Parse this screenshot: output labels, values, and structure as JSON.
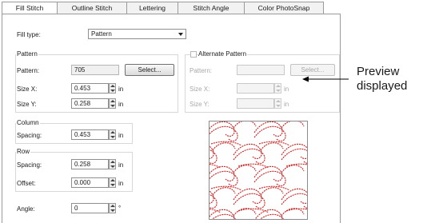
{
  "tabs": [
    "Fill Stitch",
    "Outline Stitch",
    "Lettering",
    "Stitch Angle",
    "Color PhotoSnap"
  ],
  "fill_type": {
    "label": "Fill type:",
    "value": "Pattern"
  },
  "pattern": {
    "group_title": "Pattern",
    "pattern_label": "Pattern:",
    "pattern_value": "705",
    "select_button": "Select...",
    "size_x_label": "Size X:",
    "size_x_value": "0.453",
    "size_y_label": "Size Y:",
    "size_y_value": "0.258"
  },
  "alternate_pattern": {
    "checkbox_label": "Alternate Pattern",
    "checked": false,
    "pattern_label": "Pattern:",
    "select_button": "Select...",
    "size_x_label": "Size X:",
    "size_y_label": "Size Y:"
  },
  "column": {
    "group_title": "Column",
    "spacing_label": "Spacing:",
    "spacing_value": "0.453"
  },
  "row": {
    "group_title": "Row",
    "spacing_label": "Spacing:",
    "spacing_value": "0.258",
    "offset_label": "Offset:",
    "offset_value": "0.000"
  },
  "angle": {
    "label": "Angle:",
    "value": "0",
    "unit": "°"
  },
  "units": {
    "inch": "in"
  },
  "callout": {
    "line1": "Preview",
    "line2": "displayed"
  },
  "colors": {
    "pattern_stitch": "#cc1f1f",
    "callout_arrow": "#000000"
  }
}
